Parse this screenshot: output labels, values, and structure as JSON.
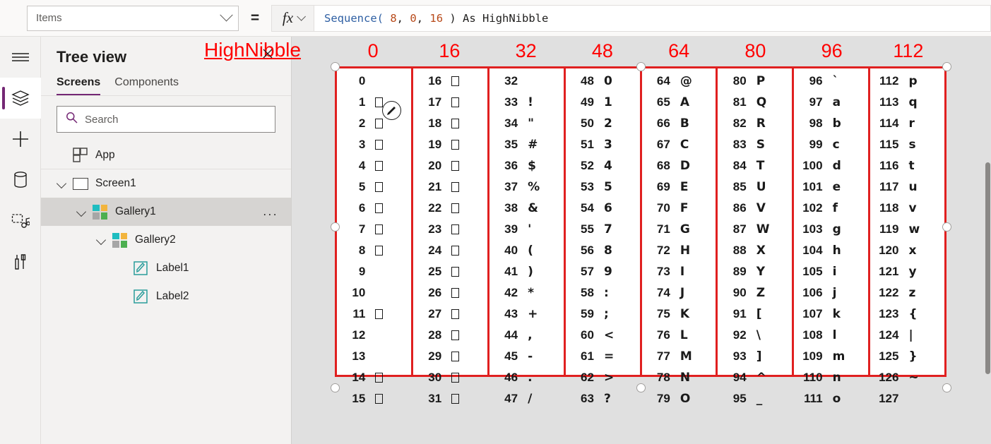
{
  "formula_bar": {
    "property_value": "Items",
    "equals": "=",
    "fx_label": "fx",
    "formula_tokens": [
      {
        "t": "Sequence(",
        "k": "fn"
      },
      {
        "t": " 8",
        "k": "num"
      },
      {
        "t": ",",
        "k": "punc"
      },
      {
        "t": " 0",
        "k": "num"
      },
      {
        "t": ",",
        "k": "punc"
      },
      {
        "t": " 16",
        "k": "num"
      },
      {
        "t": " ) ",
        "k": "punc"
      },
      {
        "t": "As HighNibble",
        "k": "plain"
      }
    ],
    "formula_text": "Sequence( 8, 0, 16 ) As HighNibble"
  },
  "rail": {
    "items": [
      {
        "name": "hamburger-menu-icon",
        "label": "Menu",
        "active": false
      },
      {
        "name": "tree-view-icon",
        "label": "Tree view",
        "active": true
      },
      {
        "name": "insert-plus-icon",
        "label": "Insert",
        "active": false
      },
      {
        "name": "data-cylinder-icon",
        "label": "Data",
        "active": false
      },
      {
        "name": "media-icon",
        "label": "Media",
        "active": false
      },
      {
        "name": "tools-icon",
        "label": "Advanced tools",
        "active": false
      }
    ]
  },
  "tree": {
    "title": "Tree view",
    "tabs": [
      {
        "label": "Screens",
        "selected": true
      },
      {
        "label": "Components",
        "selected": false
      }
    ],
    "search": {
      "placeholder": "Search",
      "value": ""
    },
    "items": [
      {
        "label": "App",
        "indent": 1,
        "twisty": false,
        "icon": "app-icon",
        "selected": false,
        "dots": false
      },
      {
        "label": "Screen1",
        "indent": 1,
        "twisty": true,
        "icon": "screen-icon",
        "selected": false,
        "dots": false
      },
      {
        "label": "Gallery1",
        "indent": 2,
        "twisty": true,
        "icon": "gallery-icon",
        "selected": true,
        "dots": true,
        "dots_label": "..."
      },
      {
        "label": "Gallery2",
        "indent": 3,
        "twisty": true,
        "icon": "gallery-icon",
        "selected": false,
        "dots": false
      },
      {
        "label": "Label1",
        "indent": 4,
        "twisty": false,
        "icon": "label-icon",
        "selected": false,
        "dots": false
      },
      {
        "label": "Label2",
        "indent": 4,
        "twisty": false,
        "icon": "label-icon",
        "selected": false,
        "dots": false
      }
    ]
  },
  "canvas": {
    "annotation_title": "HighNibble",
    "annotation_color": "#ff0000",
    "border_color": "#e02020",
    "column_headers": [
      "0",
      "16",
      "32",
      "48",
      "64",
      "80",
      "96",
      "112"
    ],
    "columns": [
      {
        "header": "0",
        "cells": [
          {
            "num": "0",
            "chr": "",
            "box": false
          },
          {
            "num": "1",
            "chr": "",
            "box": true
          },
          {
            "num": "2",
            "chr": "",
            "box": true
          },
          {
            "num": "3",
            "chr": "",
            "box": true
          },
          {
            "num": "4",
            "chr": "",
            "box": true
          },
          {
            "num": "5",
            "chr": "",
            "box": true
          },
          {
            "num": "6",
            "chr": "",
            "box": true
          },
          {
            "num": "7",
            "chr": "",
            "box": true
          },
          {
            "num": "8",
            "chr": "",
            "box": true
          },
          {
            "num": "9",
            "chr": "",
            "box": false
          },
          {
            "num": "10",
            "chr": "",
            "box": false
          },
          {
            "num": "11",
            "chr": "",
            "box": true
          },
          {
            "num": "12",
            "chr": "",
            "box": false
          },
          {
            "num": "13",
            "chr": "",
            "box": false
          },
          {
            "num": "14",
            "chr": "",
            "box": true
          },
          {
            "num": "15",
            "chr": "",
            "box": true
          }
        ]
      },
      {
        "header": "16",
        "cells": [
          {
            "num": "16",
            "chr": "",
            "box": true
          },
          {
            "num": "17",
            "chr": "",
            "box": true
          },
          {
            "num": "18",
            "chr": "",
            "box": true
          },
          {
            "num": "19",
            "chr": "",
            "box": true
          },
          {
            "num": "20",
            "chr": "",
            "box": true
          },
          {
            "num": "21",
            "chr": "",
            "box": true
          },
          {
            "num": "22",
            "chr": "",
            "box": true
          },
          {
            "num": "23",
            "chr": "",
            "box": true
          },
          {
            "num": "24",
            "chr": "",
            "box": true
          },
          {
            "num": "25",
            "chr": "",
            "box": true
          },
          {
            "num": "26",
            "chr": "",
            "box": true
          },
          {
            "num": "27",
            "chr": "",
            "box": true
          },
          {
            "num": "28",
            "chr": "",
            "box": true
          },
          {
            "num": "29",
            "chr": "",
            "box": true
          },
          {
            "num": "30",
            "chr": "",
            "box": true
          },
          {
            "num": "31",
            "chr": "",
            "box": true
          }
        ]
      },
      {
        "header": "32",
        "cells": [
          {
            "num": "32",
            "chr": "",
            "box": false
          },
          {
            "num": "33",
            "chr": "!",
            "box": false
          },
          {
            "num": "34",
            "chr": "\"",
            "box": false
          },
          {
            "num": "35",
            "chr": "#",
            "box": false
          },
          {
            "num": "36",
            "chr": "$",
            "box": false
          },
          {
            "num": "37",
            "chr": "%",
            "box": false
          },
          {
            "num": "38",
            "chr": "&",
            "box": false
          },
          {
            "num": "39",
            "chr": "'",
            "box": false
          },
          {
            "num": "40",
            "chr": "(",
            "box": false
          },
          {
            "num": "41",
            "chr": ")",
            "box": false
          },
          {
            "num": "42",
            "chr": "*",
            "box": false
          },
          {
            "num": "43",
            "chr": "+",
            "box": false
          },
          {
            "num": "44",
            "chr": ",",
            "box": false
          },
          {
            "num": "45",
            "chr": "-",
            "box": false
          },
          {
            "num": "46",
            "chr": ".",
            "box": false
          },
          {
            "num": "47",
            "chr": "/",
            "box": false
          }
        ]
      },
      {
        "header": "48",
        "cells": [
          {
            "num": "48",
            "chr": "0",
            "box": false
          },
          {
            "num": "49",
            "chr": "1",
            "box": false
          },
          {
            "num": "50",
            "chr": "2",
            "box": false
          },
          {
            "num": "51",
            "chr": "3",
            "box": false
          },
          {
            "num": "52",
            "chr": "4",
            "box": false
          },
          {
            "num": "53",
            "chr": "5",
            "box": false
          },
          {
            "num": "54",
            "chr": "6",
            "box": false
          },
          {
            "num": "55",
            "chr": "7",
            "box": false
          },
          {
            "num": "56",
            "chr": "8",
            "box": false
          },
          {
            "num": "57",
            "chr": "9",
            "box": false
          },
          {
            "num": "58",
            "chr": ":",
            "box": false
          },
          {
            "num": "59",
            "chr": ";",
            "box": false
          },
          {
            "num": "60",
            "chr": "<",
            "box": false
          },
          {
            "num": "61",
            "chr": "=",
            "box": false
          },
          {
            "num": "62",
            "chr": ">",
            "box": false
          },
          {
            "num": "63",
            "chr": "?",
            "box": false
          }
        ]
      },
      {
        "header": "64",
        "cells": [
          {
            "num": "64",
            "chr": "@",
            "box": false
          },
          {
            "num": "65",
            "chr": "A",
            "box": false
          },
          {
            "num": "66",
            "chr": "B",
            "box": false
          },
          {
            "num": "67",
            "chr": "C",
            "box": false
          },
          {
            "num": "68",
            "chr": "D",
            "box": false
          },
          {
            "num": "69",
            "chr": "E",
            "box": false
          },
          {
            "num": "70",
            "chr": "F",
            "box": false
          },
          {
            "num": "71",
            "chr": "G",
            "box": false
          },
          {
            "num": "72",
            "chr": "H",
            "box": false
          },
          {
            "num": "73",
            "chr": "I",
            "box": false
          },
          {
            "num": "74",
            "chr": "J",
            "box": false
          },
          {
            "num": "75",
            "chr": "K",
            "box": false
          },
          {
            "num": "76",
            "chr": "L",
            "box": false
          },
          {
            "num": "77",
            "chr": "M",
            "box": false
          },
          {
            "num": "78",
            "chr": "N",
            "box": false
          },
          {
            "num": "79",
            "chr": "O",
            "box": false
          }
        ]
      },
      {
        "header": "80",
        "cells": [
          {
            "num": "80",
            "chr": "P",
            "box": false
          },
          {
            "num": "81",
            "chr": "Q",
            "box": false
          },
          {
            "num": "82",
            "chr": "R",
            "box": false
          },
          {
            "num": "83",
            "chr": "S",
            "box": false
          },
          {
            "num": "84",
            "chr": "T",
            "box": false
          },
          {
            "num": "85",
            "chr": "U",
            "box": false
          },
          {
            "num": "86",
            "chr": "V",
            "box": false
          },
          {
            "num": "87",
            "chr": "W",
            "box": false
          },
          {
            "num": "88",
            "chr": "X",
            "box": false
          },
          {
            "num": "89",
            "chr": "Y",
            "box": false
          },
          {
            "num": "90",
            "chr": "Z",
            "box": false
          },
          {
            "num": "91",
            "chr": "[",
            "box": false
          },
          {
            "num": "92",
            "chr": "\\",
            "box": false
          },
          {
            "num": "93",
            "chr": "]",
            "box": false
          },
          {
            "num": "94",
            "chr": "^",
            "box": false
          },
          {
            "num": "95",
            "chr": "_",
            "box": false
          }
        ]
      },
      {
        "header": "96",
        "cells": [
          {
            "num": "96",
            "chr": "`",
            "box": false
          },
          {
            "num": "97",
            "chr": "a",
            "box": false
          },
          {
            "num": "98",
            "chr": "b",
            "box": false
          },
          {
            "num": "99",
            "chr": "c",
            "box": false
          },
          {
            "num": "100",
            "chr": "d",
            "box": false
          },
          {
            "num": "101",
            "chr": "e",
            "box": false
          },
          {
            "num": "102",
            "chr": "f",
            "box": false
          },
          {
            "num": "103",
            "chr": "g",
            "box": false
          },
          {
            "num": "104",
            "chr": "h",
            "box": false
          },
          {
            "num": "105",
            "chr": "i",
            "box": false
          },
          {
            "num": "106",
            "chr": "j",
            "box": false
          },
          {
            "num": "107",
            "chr": "k",
            "box": false
          },
          {
            "num": "108",
            "chr": "l",
            "box": false
          },
          {
            "num": "109",
            "chr": "m",
            "box": false
          },
          {
            "num": "110",
            "chr": "n",
            "box": false
          },
          {
            "num": "111",
            "chr": "o",
            "box": false
          }
        ]
      },
      {
        "header": "112",
        "cells": [
          {
            "num": "112",
            "chr": "p",
            "box": false
          },
          {
            "num": "113",
            "chr": "q",
            "box": false
          },
          {
            "num": "114",
            "chr": "r",
            "box": false
          },
          {
            "num": "115",
            "chr": "s",
            "box": false
          },
          {
            "num": "116",
            "chr": "t",
            "box": false
          },
          {
            "num": "117",
            "chr": "u",
            "box": false
          },
          {
            "num": "118",
            "chr": "v",
            "box": false
          },
          {
            "num": "119",
            "chr": "w",
            "box": false
          },
          {
            "num": "120",
            "chr": "x",
            "box": false
          },
          {
            "num": "121",
            "chr": "y",
            "box": false
          },
          {
            "num": "122",
            "chr": "z",
            "box": false
          },
          {
            "num": "123",
            "chr": "{",
            "box": false
          },
          {
            "num": "124",
            "chr": "|",
            "box": false
          },
          {
            "num": "125",
            "chr": "}",
            "box": false
          },
          {
            "num": "126",
            "chr": "~",
            "box": false
          },
          {
            "num": "127",
            "chr": "",
            "box": false
          }
        ]
      }
    ]
  }
}
